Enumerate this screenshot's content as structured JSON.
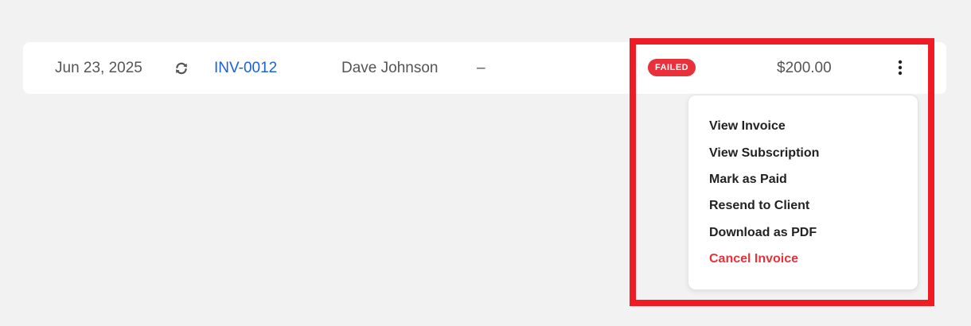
{
  "invoice_row": {
    "date": "Jun 23, 2025",
    "recurring_icon": "refresh-icon",
    "invoice_number": "INV-0012",
    "client": "Dave Johnson",
    "due": "–",
    "status": "FAILED",
    "amount": "$200.00",
    "menu_icon": "kebab-menu-icon"
  },
  "actions_menu": {
    "items": [
      {
        "label": "View Invoice"
      },
      {
        "label": "View Subscription"
      },
      {
        "label": "Mark as Paid"
      },
      {
        "label": "Resend to Client"
      },
      {
        "label": "Download as PDF"
      },
      {
        "label": "Cancel Invoice"
      }
    ]
  },
  "colors": {
    "background": "#f2f2f2",
    "row_background": "#ffffff",
    "link": "#1a5fe0",
    "status_failed": "#e8313a",
    "danger_text": "#e8313a",
    "highlight_border": "#ee1c25"
  }
}
